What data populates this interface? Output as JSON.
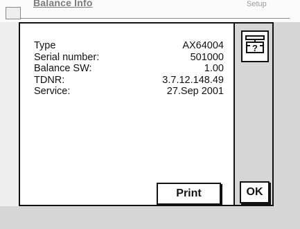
{
  "background": {
    "title": "Balance Info",
    "setup_label": "Setup"
  },
  "dialog": {
    "rows": [
      {
        "label": "Type",
        "value": "AX64004"
      },
      {
        "label": "Serial number:",
        "value": "501000"
      },
      {
        "label": "Balance SW:",
        "value": "1.00"
      },
      {
        "label": "TDNR:",
        "value": "3.7.12.148.49"
      },
      {
        "label": "Service:",
        "value": "27.Sep 2001"
      }
    ],
    "print_label": "Print",
    "ok_label": "OK"
  },
  "icons": {
    "balance_info": "balance-help-icon"
  }
}
